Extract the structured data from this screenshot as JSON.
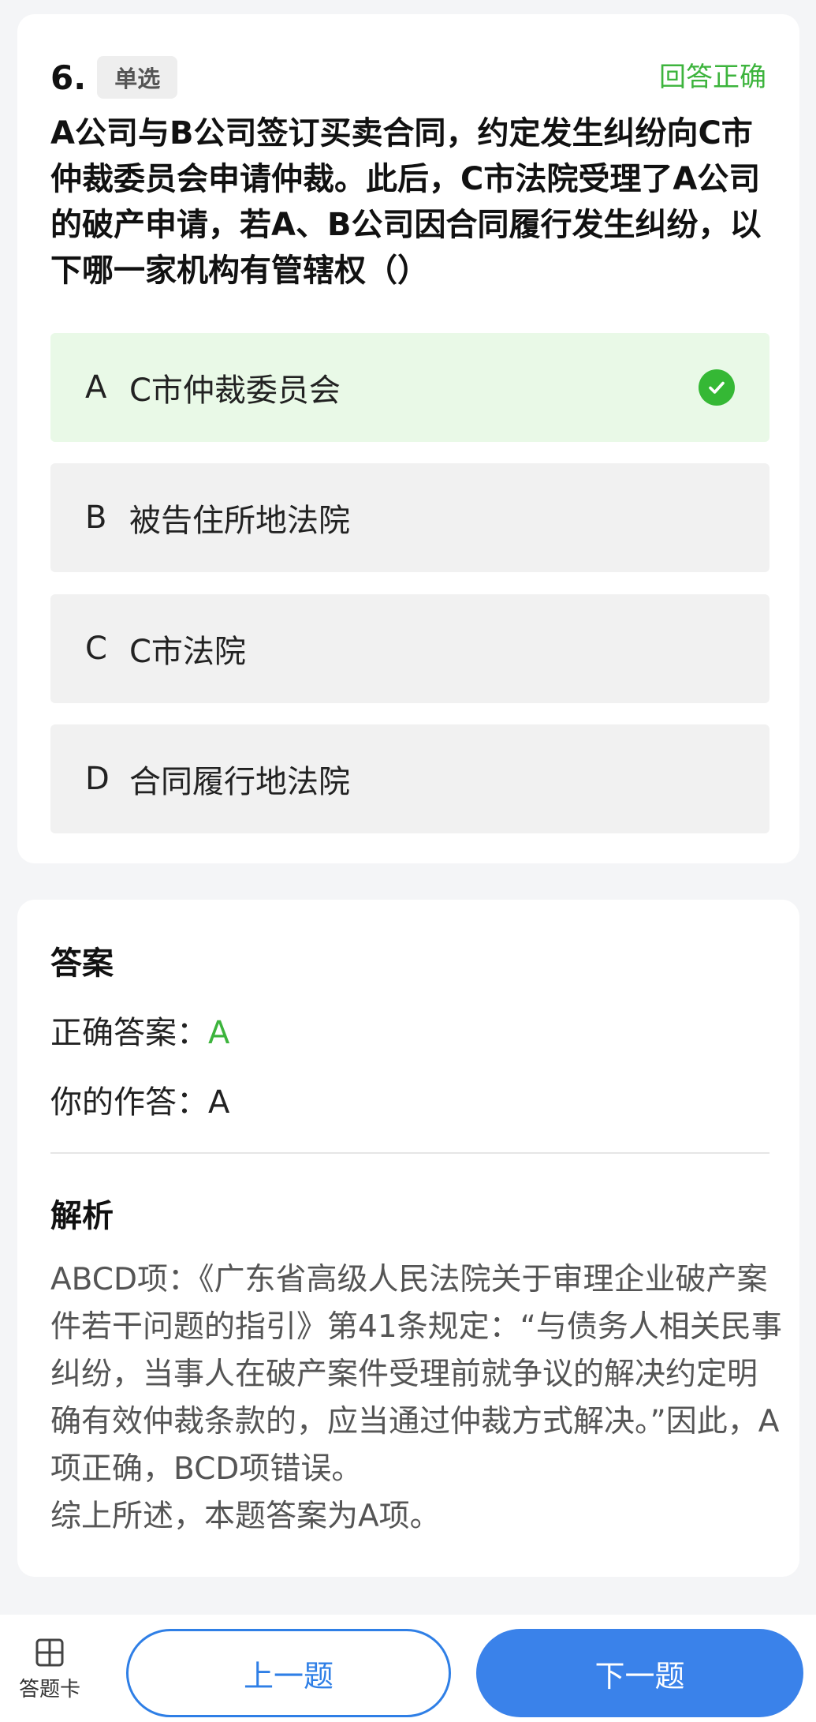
{
  "question": {
    "number": "6.",
    "type_label": "单选",
    "status": "回答正确",
    "text": "A公司与B公司签订买卖合同，约定发生纠纷向C市仲裁委员会申请仲裁。此后，C市法院受理了A公司的破产申请，若A、B公司因合同履行发生纠纷，以下哪一家机构有管辖权（）",
    "options": [
      {
        "letter": "A",
        "text": "C市仲裁委员会",
        "selected_correct": true
      },
      {
        "letter": "B",
        "text": "被告住所地法院",
        "selected_correct": false
      },
      {
        "letter": "C",
        "text": "C市法院",
        "selected_correct": false
      },
      {
        "letter": "D",
        "text": "合同履行地法院",
        "selected_correct": false
      }
    ]
  },
  "answer": {
    "title": "答案",
    "correct_label": "正确答案：",
    "correct_value": "A",
    "yours_label": "你的作答：",
    "yours_value": "A"
  },
  "analysis": {
    "title": "解析",
    "text": "ABCD项：《广东省高级人民法院关于审理企业破产案件若干问题的指引》第41条规定：“与债务人相关民事纠纷，当事人在破产案件受理前就争议的解决约定明确有效仲裁条款的，应当通过仲裁方式解决。”因此，A项正确，BCD项错误。",
    "summary": "综上所述，本题答案为A项。"
  },
  "bottom_bar": {
    "answer_sheet_label": "答题卡",
    "answer_sheet_icon": "grid-icon",
    "prev_label": "上一题",
    "next_label": "下一题"
  },
  "colors": {
    "accent_blue": "#3a82ea",
    "correct_green": "#3db43d",
    "correct_bg": "#e9f9e7"
  }
}
